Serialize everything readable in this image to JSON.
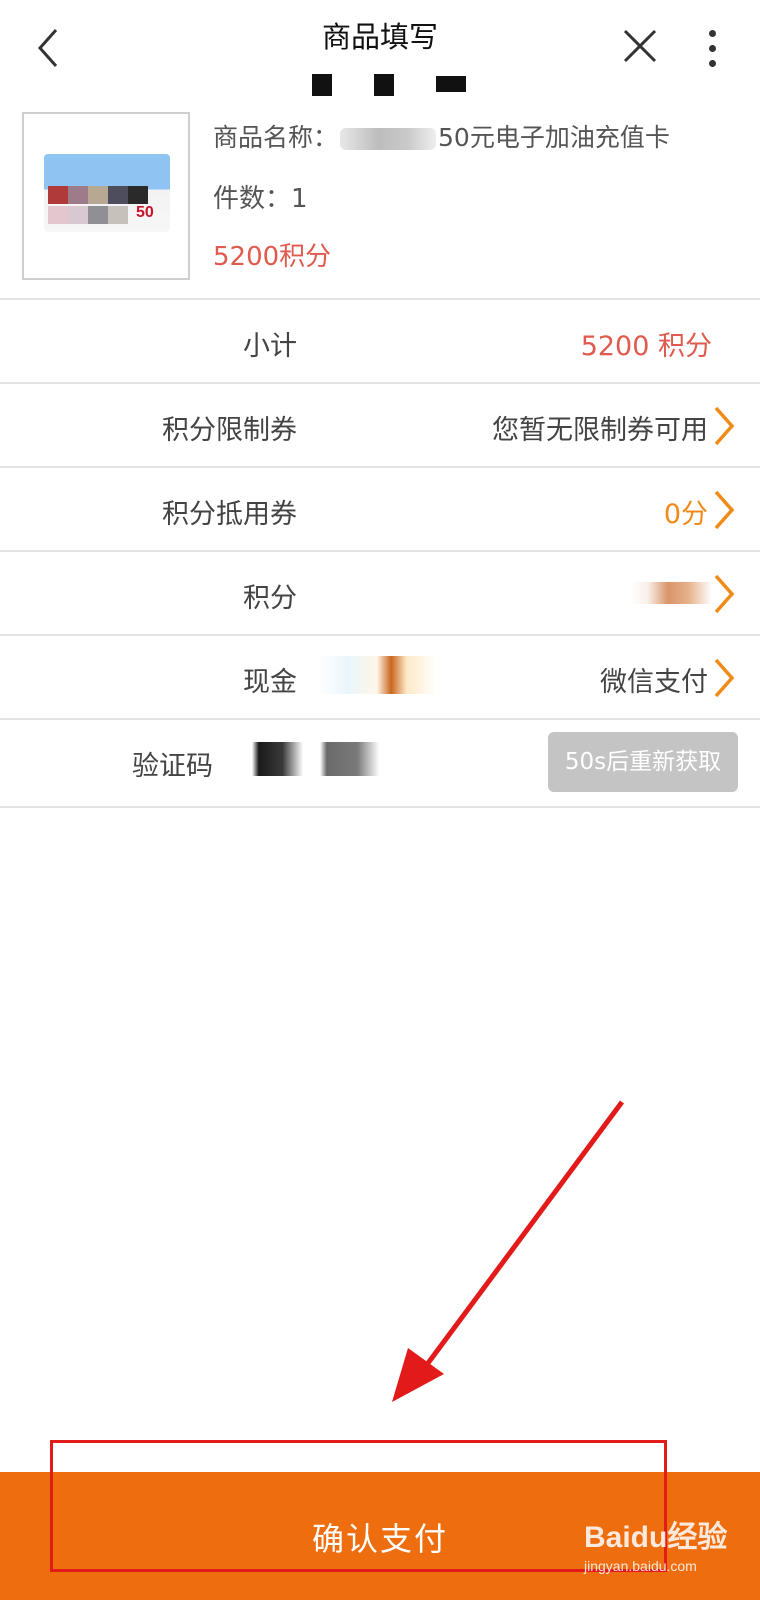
{
  "header": {
    "title": "商品填写"
  },
  "product": {
    "name_label": "商品名称：",
    "name_value": "50元电子加油充值卡",
    "quantity_text": "件数：1",
    "points_text": "5200积分",
    "card_value": "50"
  },
  "rows": {
    "subtotal": {
      "label": "小计",
      "value": "5200 积分"
    },
    "limit_coupon": {
      "label": "积分限制券",
      "value": "您暂无限制券可用"
    },
    "deduct_coupon": {
      "label": "积分抵用券",
      "value": "0分"
    },
    "points": {
      "label": "积分"
    },
    "cash": {
      "label": "现金",
      "value": "微信支付"
    },
    "captcha": {
      "label": "验证码",
      "resend_label": "50s后重新获取"
    }
  },
  "footer": {
    "confirm_label": "确认支付"
  },
  "watermark": {
    "main": "Baidu经验",
    "sub": "jingyan.baidu.com"
  },
  "colors": {
    "accent_orange": "#ee6d0f",
    "points_red": "#e05a4e",
    "chevron_orange": "#f08a18",
    "annotation_red": "#e21a1a"
  },
  "icons": {
    "back": "chevron-left-icon",
    "close": "close-icon",
    "more": "more-vertical-icon",
    "row_arrow": "chevron-right-icon"
  }
}
